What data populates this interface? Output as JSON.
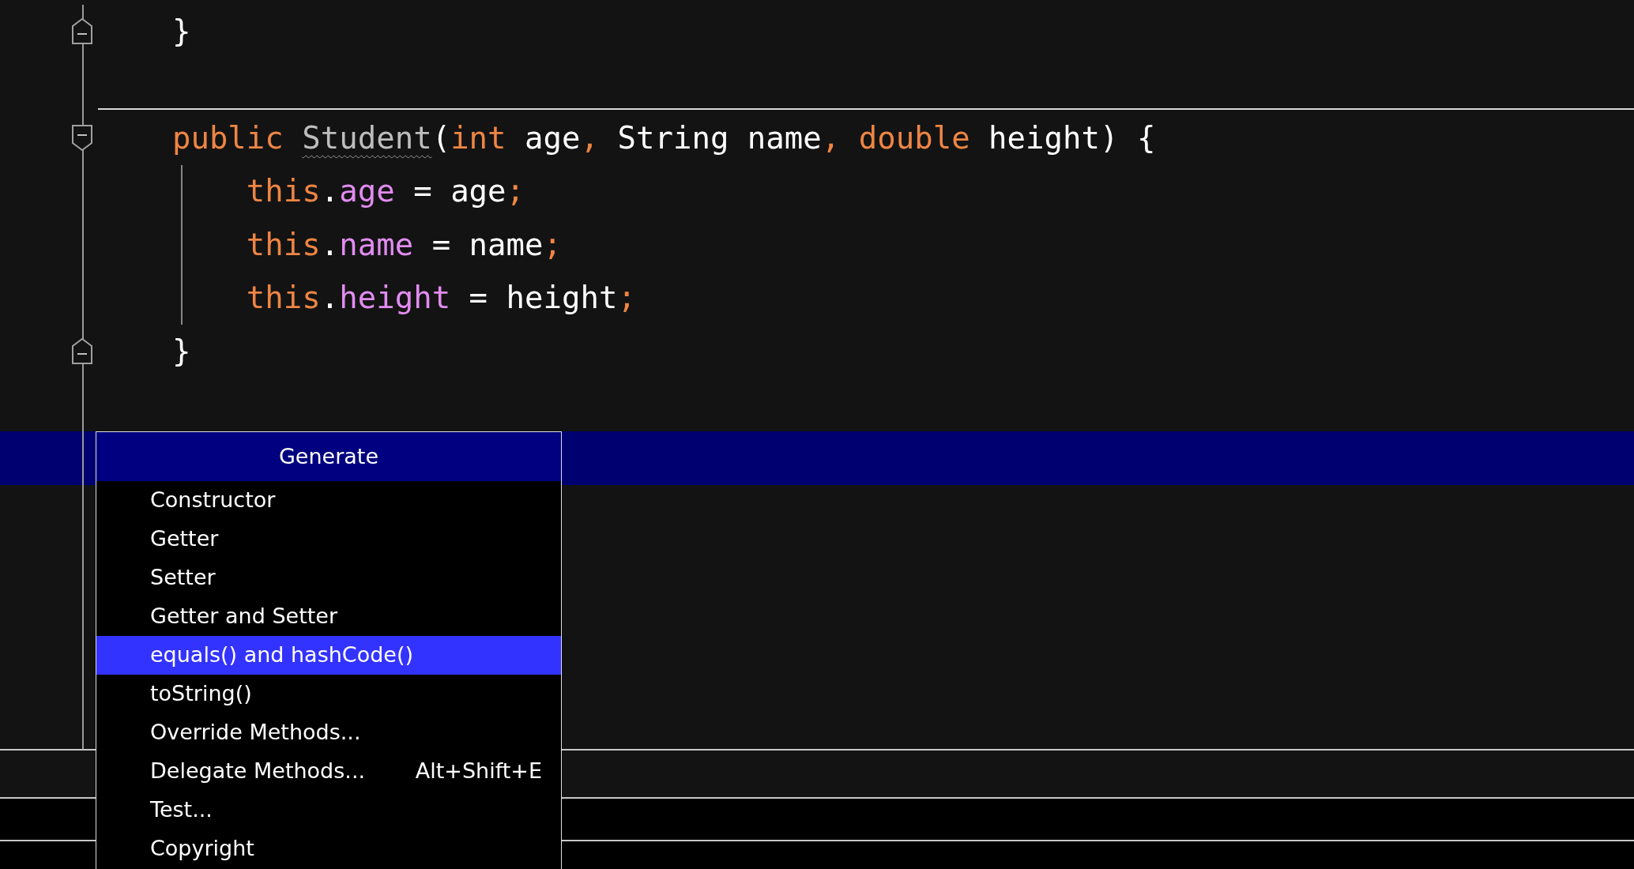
{
  "editor": {
    "lines": [
      {
        "tokens": [
          {
            "kind": "plain",
            "text": "    }"
          }
        ],
        "fold_end": true,
        "current": false
      },
      {
        "current": false
      },
      {
        "tokens": [
          {
            "kind": "keyword",
            "text": "    public "
          },
          {
            "kind": "warn",
            "text": "Student"
          },
          {
            "kind": "plain",
            "text": "("
          },
          {
            "kind": "keyword",
            "text": "int "
          },
          {
            "kind": "plain",
            "text": "age"
          },
          {
            "kind": "keyword",
            "text": ", "
          },
          {
            "kind": "plain",
            "text": "String name"
          },
          {
            "kind": "keyword",
            "text": ", double "
          },
          {
            "kind": "plain",
            "text": "height) {"
          }
        ],
        "fold_start": true,
        "current": false,
        "separator_above": true
      },
      {
        "tokens": [
          {
            "kind": "keyword",
            "text": "        this"
          },
          {
            "kind": "plain",
            "text": "."
          },
          {
            "kind": "field",
            "text": "age"
          },
          {
            "kind": "plain",
            "text": " = age"
          },
          {
            "kind": "keyword",
            "text": ";"
          }
        ],
        "current": false,
        "guide": true
      },
      {
        "tokens": [
          {
            "kind": "keyword",
            "text": "        this"
          },
          {
            "kind": "plain",
            "text": "."
          },
          {
            "kind": "field",
            "text": "name"
          },
          {
            "kind": "plain",
            "text": " = name"
          },
          {
            "kind": "keyword",
            "text": ";"
          }
        ],
        "current": false,
        "guide": true
      },
      {
        "tokens": [
          {
            "kind": "keyword",
            "text": "        this"
          },
          {
            "kind": "plain",
            "text": "."
          },
          {
            "kind": "field",
            "text": "height"
          },
          {
            "kind": "plain",
            "text": " = height"
          },
          {
            "kind": "keyword",
            "text": ";"
          }
        ],
        "current": false,
        "guide": true
      },
      {
        "tokens": [
          {
            "kind": "plain",
            "text": "    }"
          }
        ],
        "fold_end": true,
        "current": false
      },
      {
        "current": false
      },
      {
        "current": true
      }
    ]
  },
  "popup": {
    "title": "Generate",
    "items": [
      {
        "label": "Constructor",
        "selected": false
      },
      {
        "label": "Getter",
        "selected": false
      },
      {
        "label": "Setter",
        "selected": false
      },
      {
        "label": "Getter and Setter",
        "selected": false
      },
      {
        "label": "equals() and hashCode()",
        "selected": true
      },
      {
        "label": "toString()",
        "selected": false
      },
      {
        "label": "Override Methods...",
        "selected": false
      },
      {
        "label": "Delegate Methods...",
        "selected": false,
        "shortcut": "Alt+Shift+E"
      },
      {
        "label": "Test...",
        "selected": false
      },
      {
        "label": "Copyright",
        "selected": false
      }
    ]
  }
}
